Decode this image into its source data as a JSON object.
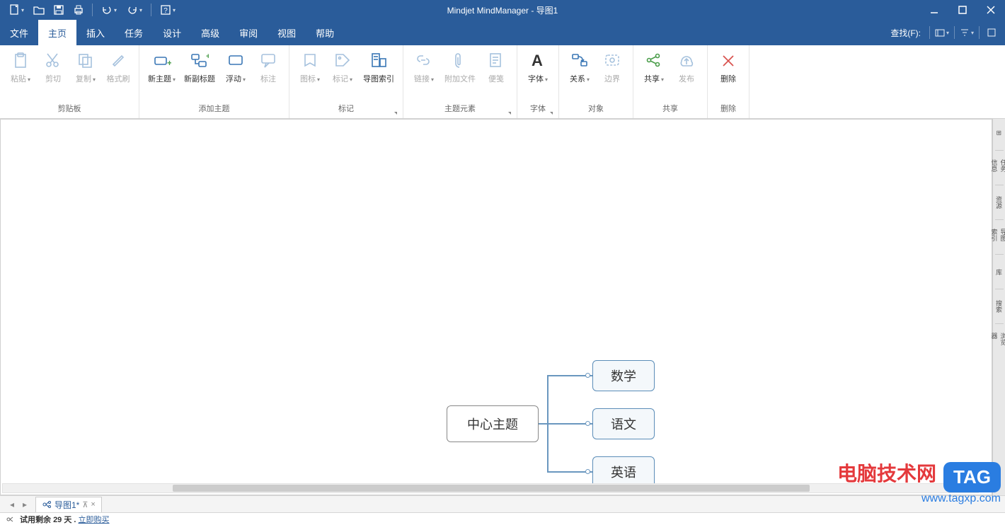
{
  "app": {
    "title": "Mindjet MindManager - 导图1"
  },
  "menu": {
    "items": [
      "文件",
      "主页",
      "插入",
      "任务",
      "设计",
      "高级",
      "审阅",
      "视图",
      "帮助"
    ],
    "active_index": 1,
    "find_label": "查找(F):"
  },
  "ribbon": {
    "groups": [
      {
        "name": "剪贴板",
        "buttons": [
          {
            "label": "粘贴",
            "icon": "paste",
            "dd": true,
            "disabled": true
          },
          {
            "label": "剪切",
            "icon": "cut",
            "disabled": true
          },
          {
            "label": "复制",
            "icon": "copy",
            "dd": true,
            "disabled": true
          },
          {
            "label": "格式刷",
            "icon": "brush",
            "disabled": true
          }
        ]
      },
      {
        "name": "添加主题",
        "buttons": [
          {
            "label": "新主题",
            "icon": "newtopic",
            "dd": true
          },
          {
            "label": "新副标题",
            "icon": "newsub"
          },
          {
            "label": "浮动",
            "icon": "float",
            "dd": true
          },
          {
            "label": "标注",
            "icon": "callout",
            "disabled": true
          }
        ]
      },
      {
        "name": "标记",
        "pop": true,
        "buttons": [
          {
            "label": "图标",
            "icon": "iconmark",
            "dd": true,
            "disabled": true
          },
          {
            "label": "标记",
            "icon": "tag",
            "dd": true,
            "disabled": true
          },
          {
            "label": "导图索引",
            "icon": "index"
          }
        ]
      },
      {
        "name": "主题元素",
        "pop": true,
        "buttons": [
          {
            "label": "链接",
            "icon": "link",
            "dd": true,
            "disabled": true
          },
          {
            "label": "附加文件",
            "icon": "attach",
            "disabled": true
          },
          {
            "label": "便笺",
            "icon": "note",
            "disabled": true
          }
        ]
      },
      {
        "name": "字体",
        "pop": true,
        "buttons": [
          {
            "label": "字体",
            "icon": "font",
            "dd": true
          }
        ]
      },
      {
        "name": "对象",
        "buttons": [
          {
            "label": "关系",
            "icon": "relation",
            "dd": true
          },
          {
            "label": "边界",
            "icon": "boundary",
            "disabled": true
          }
        ]
      },
      {
        "name": "共享",
        "buttons": [
          {
            "label": "共享",
            "icon": "share",
            "dd": true
          },
          {
            "label": "发布",
            "icon": "publish",
            "disabled": true
          }
        ]
      },
      {
        "name": "删除",
        "buttons": [
          {
            "label": "删除",
            "icon": "delete"
          }
        ]
      }
    ]
  },
  "mindmap": {
    "center": "中心主题",
    "children": [
      "数学",
      "语文",
      "英语"
    ]
  },
  "tabs": {
    "doc_name": "导图1*"
  },
  "right_panel": {
    "items": [
      "⊞",
      "任务信息",
      "资源",
      "导图索引",
      "库",
      "搜索",
      "浏览器"
    ]
  },
  "status": {
    "trial_prefix": "试用剩余 ",
    "trial_days": "29",
    "trial_suffix": " 天 . ",
    "buy": "立即购买"
  },
  "watermark": {
    "line1": "电脑技术网",
    "url": "www.tagxp.com",
    "tag": "TAG"
  }
}
